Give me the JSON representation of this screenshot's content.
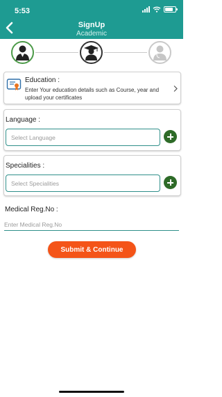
{
  "status_bar": {
    "time": "5:53"
  },
  "header": {
    "title": "SignUp",
    "subtitle": "Academic"
  },
  "steps": [
    {
      "name": "profile",
      "state": "completed"
    },
    {
      "name": "academic",
      "state": "current"
    },
    {
      "name": "professional",
      "state": "pending"
    }
  ],
  "education": {
    "title": "Education :",
    "description": "Enter Your education details such as Course, year and upload your certificates"
  },
  "language": {
    "label": "Language :",
    "placeholder": "Select Language"
  },
  "specialities": {
    "label": "Specialities :",
    "placeholder": "Select Specialities"
  },
  "medical_reg": {
    "label": "Medical Reg.No :",
    "placeholder": "Enter Medical Reg.No"
  },
  "submit": {
    "label": "Submit & Continue"
  },
  "colors": {
    "header": "#1e9b92",
    "accent": "#f45418",
    "add": "#2e6b28",
    "border": "#2f8f8a"
  }
}
